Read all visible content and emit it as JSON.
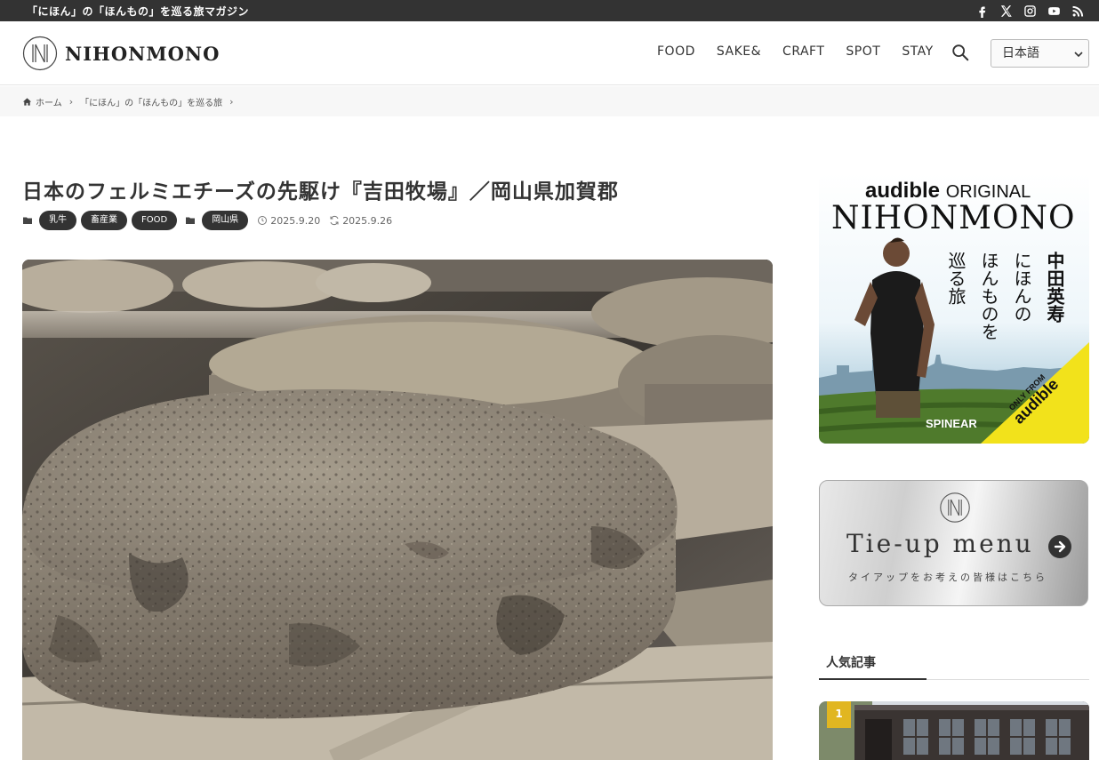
{
  "topbar": {
    "tagline": "「にほん」の「ほんもの」を巡る旅マガジン",
    "social": [
      "facebook-icon",
      "x-icon",
      "instagram-icon",
      "youtube-icon",
      "rss-icon"
    ]
  },
  "header": {
    "logo_text": "NIHONMONO",
    "nav": [
      "FOOD",
      "SAKE&",
      "CRAFT",
      "SPOT",
      "STAY"
    ],
    "language": "日本語"
  },
  "breadcrumb": {
    "home": "ホーム",
    "category": "「にほん」の「ほんもの」を巡る旅"
  },
  "article": {
    "title": "日本のフェルミエチーズの先駆け『吉田牧場』／岡山県加賀郡",
    "tags": [
      "乳牛",
      "畜産業",
      "FOOD"
    ],
    "region": "岡山県",
    "published": "2025.9.20",
    "updated": "2025.9.26"
  },
  "sidebar": {
    "ad": {
      "brand_top": "audible",
      "brand_original": "ORIGINAL",
      "title": "NIHONMONO",
      "vertical_lines": [
        "中田英寿",
        "にほんの",
        "ほんものを",
        "巡る旅"
      ],
      "sponsor": "SPINEAR",
      "ribbon_small": "ONLY FROM",
      "ribbon_brand": "audible"
    },
    "tieup": {
      "title": "Tie-up menu",
      "subtitle": "タイアップをお考えの皆様はこちら"
    },
    "popular": {
      "heading": "人気記事",
      "rank": "1"
    }
  },
  "colors": {
    "topbar": "#333333",
    "tag_bg": "#333333",
    "rank_badge": "#e1b621",
    "breadcrumb_bg": "#f7f7f7"
  }
}
